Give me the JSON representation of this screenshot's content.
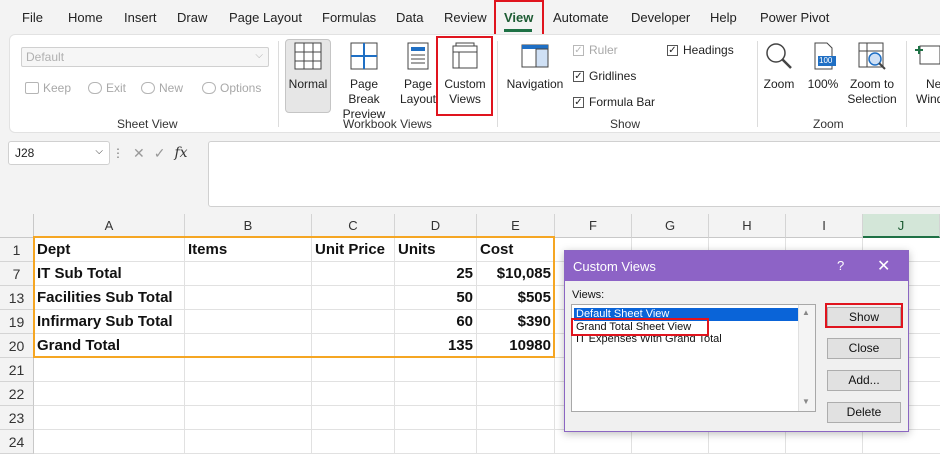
{
  "menu": {
    "tabs": [
      "File",
      "Home",
      "Insert",
      "Draw",
      "Page Layout",
      "Formulas",
      "Data",
      "Review",
      "View",
      "Automate",
      "Developer",
      "Help",
      "Power Pivot"
    ],
    "active": "View"
  },
  "ribbon": {
    "sheet_view": {
      "dropdown_value": "Default",
      "keep": "Keep",
      "exit": "Exit",
      "new": "New",
      "options": "Options",
      "label": "Sheet View"
    },
    "workbook_views": {
      "normal": "Normal",
      "page_break_1": "Page Break",
      "page_break_2": "Preview",
      "page_layout_1": "Page",
      "page_layout_2": "Layout",
      "custom_views_1": "Custom",
      "custom_views_2": "Views",
      "label": "Workbook Views"
    },
    "show": {
      "navigation": "Navigation",
      "ruler": "Ruler",
      "gridlines": "Gridlines",
      "formula_bar": "Formula Bar",
      "headings": "Headings",
      "label": "Show"
    },
    "zoom": {
      "zoom": "Zoom",
      "hundred": "100%",
      "icon_badge": "100",
      "zoom_to_1": "Zoom to",
      "zoom_to_2": "Selection",
      "label": "Zoom"
    },
    "window": {
      "new_window_1": "Ne",
      "new_window_2": "Wind"
    }
  },
  "formula_bar": {
    "name_box": "J28",
    "fx": "fx"
  },
  "sheet": {
    "columns": [
      "A",
      "B",
      "C",
      "D",
      "E",
      "F",
      "G",
      "H",
      "I",
      "J"
    ],
    "row_numbers": [
      "1",
      "7",
      "13",
      "19",
      "20",
      "21",
      "22",
      "23",
      "24"
    ],
    "header": {
      "dept": "Dept",
      "items": "Items",
      "unit_price": "Unit Price",
      "units": "Units",
      "cost": "Cost"
    },
    "rows": [
      {
        "dept": "IT Sub Total",
        "units": "25",
        "cost": "$10,085"
      },
      {
        "dept": "Facilities Sub Total",
        "units": "50",
        "cost": "$505"
      },
      {
        "dept": "Infirmary Sub Total",
        "units": "60",
        "cost": "$390"
      },
      {
        "dept": "Grand Total",
        "units": "135",
        "cost": "10980"
      }
    ]
  },
  "dialog": {
    "title": "Custom Views",
    "help": "?",
    "close": "✕",
    "views_label": "Views:",
    "views": [
      "Default Sheet View",
      "Grand Total Sheet View",
      "IT Expenses With Grand Total"
    ],
    "selected_index": 0,
    "buttons": {
      "show": "Show",
      "close": "Close",
      "add": "Add...",
      "delete": "Delete"
    }
  },
  "colors": {
    "excel_green": "#1e7145",
    "highlight_red": "#e0141e",
    "dialog_purple": "#8d63c6",
    "selection_orange": "#f5a623",
    "list_selection": "#0a64d8"
  }
}
